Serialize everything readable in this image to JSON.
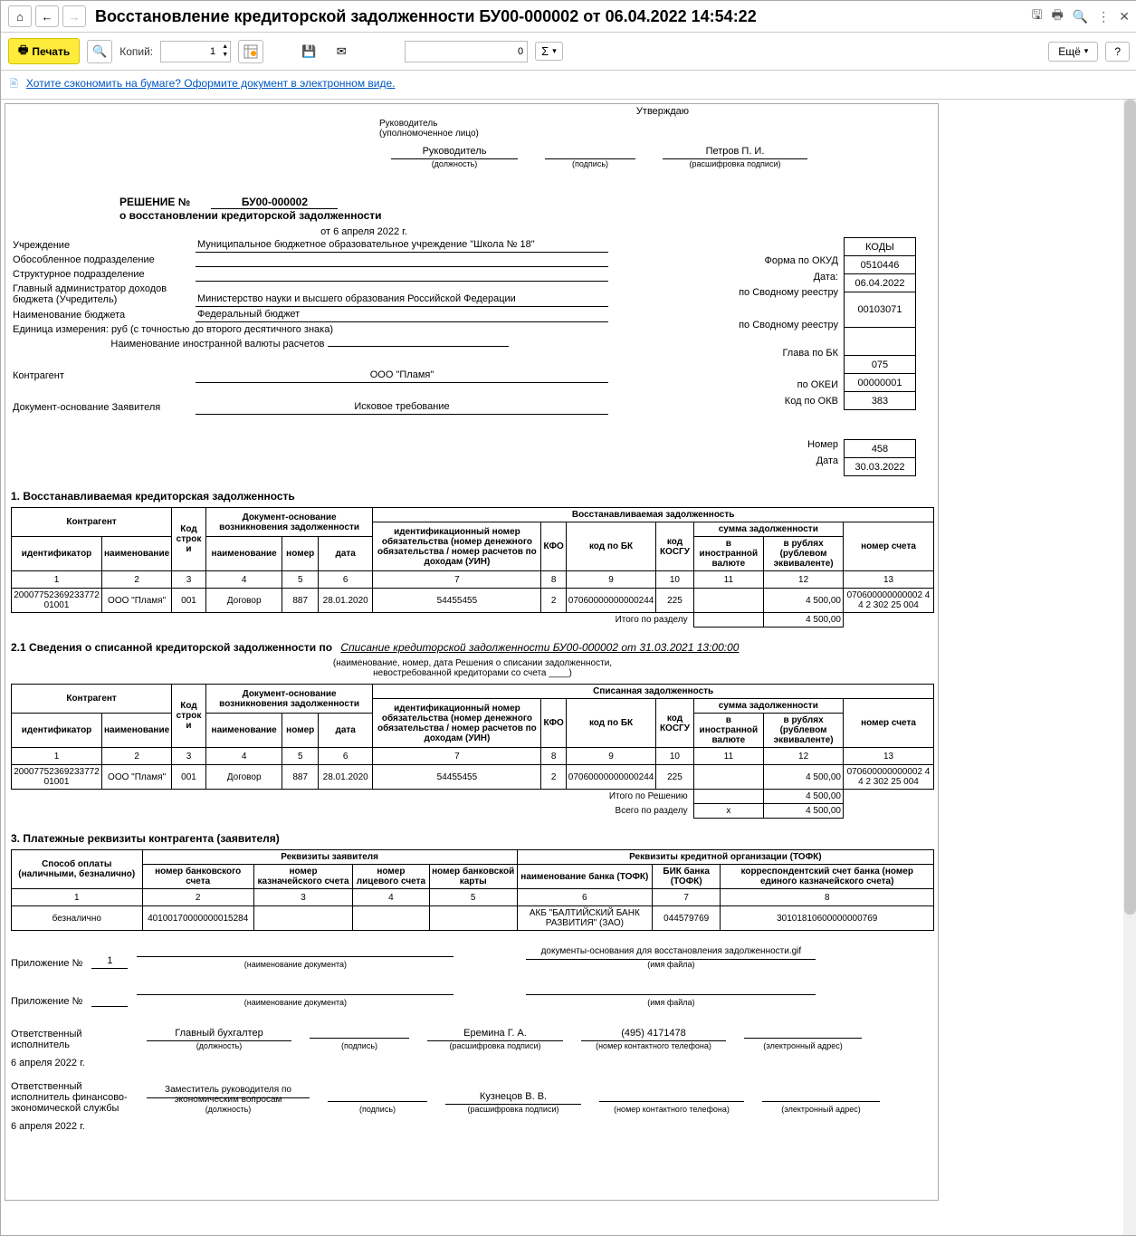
{
  "title": "Восстановление кредиторской задолженности БУ00-000002 от 06.04.2022 14:54:22",
  "toolbar": {
    "print": "Печать",
    "copies_label": "Копий:",
    "copies_value": "1",
    "num_value": "0",
    "more": "Ещё"
  },
  "banner": {
    "text": "Хотите сэкономить на бумаге? Оформите документ в электронном виде."
  },
  "approve": {
    "title": "Утверждаю",
    "role1": "Руководитель",
    "role1_sub": "(уполномоченное лицо)",
    "position": "Руководитель",
    "position_sub": "(должность)",
    "sign_sub": "(подпись)",
    "name": "Петров П. И.",
    "name_sub": "(расшифровка подписи)"
  },
  "doc": {
    "resolution": "РЕШЕНИЕ №",
    "number": "БУ00-000002",
    "subtitle": "о восстановлении кредиторской задолженности",
    "date": "от 6 апреля 2022 г."
  },
  "meta": {
    "l1": "Учреждение",
    "v1": "Муниципальное бюджетное образовательное учреждение \"Школа № 18\"",
    "l2": "Обособленное подразделение",
    "l3": "Структурное подразделение",
    "l4": "Главный администратор доходов бюджета (Учредитель)",
    "v4": "Министерство науки и высшего образования Российской Федерации",
    "l5": "Наименование бюджета",
    "v5": "Федеральный бюджет",
    "l6": "Единица измерения: руб (с точностью до второго десятичного знака)",
    "l7": "Наименование иностранной валюты расчетов",
    "l8": "Контрагент",
    "v8": "ООО \"Пламя\"",
    "l9": "Документ-основание Заявителя",
    "v9": "Исковое требование"
  },
  "right_labels": {
    "r1": "Форма по ОКУД",
    "r2": "Дата:",
    "r3": "по Сводному реестру",
    "r4": "по Сводному реестру",
    "r5": "Глава по БК",
    "r6": "по ОКЕИ",
    "r7": "Код по ОКВ",
    "r8": "Номер",
    "r9": "Дата"
  },
  "codes": {
    "hdr": "КОДЫ",
    "c1": "0510446",
    "c2": "06.04.2022",
    "c3": "00103071",
    "c4": "",
    "c5": "075",
    "c6": "00000001",
    "c7": "383",
    "c8": "",
    "c9": "458",
    "c10": "30.03.2022"
  },
  "s1": {
    "title": "1. Восстанавливаемая кредиторская задолженность",
    "h_contr": "Контрагент",
    "h_line": "Код строк и",
    "h_doc": "Документ-основание возникновения задолженности",
    "h_rest": "Восстанавливаемая задолженность",
    "h_id": "идентификационный номер обязательства (номер денежного обязательства / номер расчетов по доходам (УИН)",
    "h_kfo": "КФО",
    "h_bk": "код по БК",
    "h_kosgu": "код КОСГУ",
    "h_sum": "сумма задолженности",
    "h_acct": "номер счета",
    "h_ident": "идентификатор",
    "h_name": "наименование",
    "h_dnum": "номер",
    "h_ddate": "дата",
    "h_fcur": "в иностранной валюте",
    "h_rub": "в рублях (рублевом эквиваленте)",
    "r": {
      "c1": "2000775236923377201001",
      "c2": "ООО \"Пламя\"",
      "c3": "001",
      "c4": "Договор",
      "c5": "887",
      "c6": "28.01.2020",
      "c7": "54455455",
      "c8": "2",
      "c9": "07060000000000244",
      "c10": "225",
      "c11": "",
      "c12": "4 500,00",
      "c13": "070600000000002 44 2 302 25 004"
    },
    "tot_label": "Итого по разделу",
    "tot_val": "4 500,00"
  },
  "s2": {
    "title_pre": "2.1 Сведения о списанной кредиторской задолженности по",
    "title_link": "Списание кредиторской задолженности БУ00-000002 от 31.03.2021 13:00:00",
    "sub1": "(наименование, номер, дата Решения о списании задолженности,",
    "sub2": "невостребованной кредиторами со счета ____)",
    "h_rest": "Списанная задолженность",
    "r": {
      "c1": "2000775236923377201001",
      "c2": "ООО \"Пламя\"",
      "c3": "001",
      "c4": "Договор",
      "c5": "887",
      "c6": "28.01.2020",
      "c7": "54455455",
      "c8": "2",
      "c9": "07060000000000244",
      "c10": "225",
      "c11": "",
      "c12": "4 500,00",
      "c13": "070600000000002 44 2 302 25 004"
    },
    "tot1_label": "Итого по Решению",
    "tot1_val": "4 500,00",
    "tot2_label": "Всего по разделу",
    "tot2_x": "x",
    "tot2_val": "4 500,00"
  },
  "s3": {
    "title": "3. Платежные реквизиты контрагента (заявителя)",
    "h_pay": "Способ оплаты (наличными, безналично)",
    "h_req": "Реквизиты заявителя",
    "h_cred": "Реквизиты кредитной организации (ТОФК)",
    "h_bank_acc": "номер банковского счета",
    "h_treasury": "номер казначейского счета",
    "h_personal": "номер лицевого счета",
    "h_card": "номер банковской карты",
    "h_bank_name": "наименование банка (ТОФК)",
    "h_bik": "БИК банка (ТОФК)",
    "h_corr": "корреспондентский счет банка (номер единого казначейского счета)",
    "r": {
      "c1": "безналично",
      "c2": "40100170000000015284",
      "c3": "",
      "c4": "",
      "c5": "",
      "c6": "АКБ \"БАЛТИЙСКИЙ БАНК РАЗВИТИЯ\" (ЗАО)",
      "c7": "044579769",
      "c8": "30101810600000000769"
    }
  },
  "appendix": {
    "label": "Приложение №",
    "num1": "1",
    "docname_sub": "(наименование документа)",
    "file_label": "документы-основания для восстановления задолженности.gif",
    "file_sub": "(имя файла)"
  },
  "signers": {
    "exec_label": "Ответственный исполнитель",
    "exec_pos": "Главный бухгалтер",
    "pos_sub": "(должность)",
    "sign_sub": "(подпись)",
    "exec_name": "Еремина Г. А.",
    "name_sub": "(расшифровка подписи)",
    "phone": "(495) 4171478",
    "phone_sub": "(номер контактного телефона)",
    "email_sub": "(электронный адрес)",
    "date": "6 апреля 2022 г.",
    "fin_label": "Ответственный исполнитель финансово-экономической службы",
    "fin_pos": "Заместитель руководителя по экономическим вопросам",
    "fin_name": "Кузнецов В. В."
  }
}
